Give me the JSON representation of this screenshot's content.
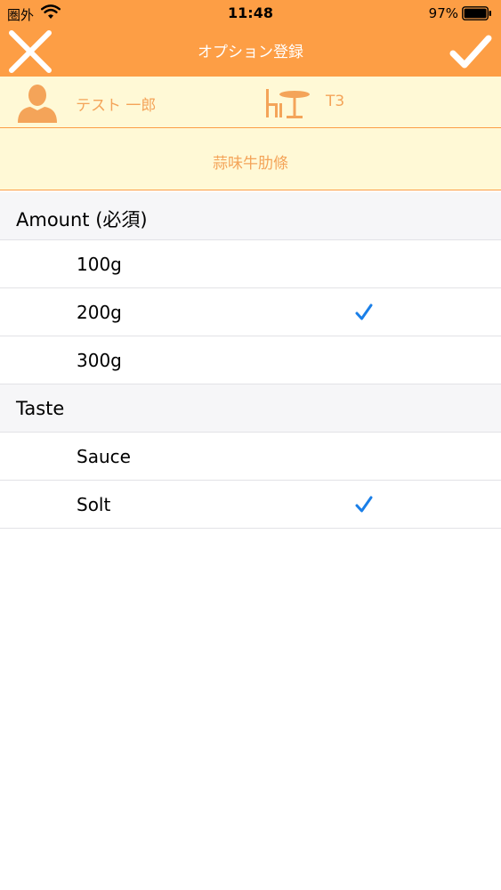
{
  "status_bar": {
    "carrier": "圏外",
    "time": "11:48",
    "battery": "97%"
  },
  "nav": {
    "title": "オプション登録",
    "close_icon": "close-icon",
    "done_icon": "checkmark-icon"
  },
  "info": {
    "person_name": "テスト 一郎",
    "table_label": "T3",
    "person_icon": "person-icon",
    "table_icon": "table-chairs-icon"
  },
  "product": {
    "name": "蒜味牛肋條"
  },
  "colors": {
    "accent": "#fd9e45",
    "info_background": "#fff9d6",
    "info_text": "#f4a459",
    "check": "#1a7fe8"
  },
  "sections": [
    {
      "title": "Amount (必須)",
      "options": [
        {
          "label": "100g",
          "selected": false
        },
        {
          "label": "200g",
          "selected": true
        },
        {
          "label": "300g",
          "selected": false
        }
      ]
    },
    {
      "title": "Taste",
      "options": [
        {
          "label": "Sauce",
          "selected": false
        },
        {
          "label": "Solt",
          "selected": true
        }
      ]
    }
  ]
}
